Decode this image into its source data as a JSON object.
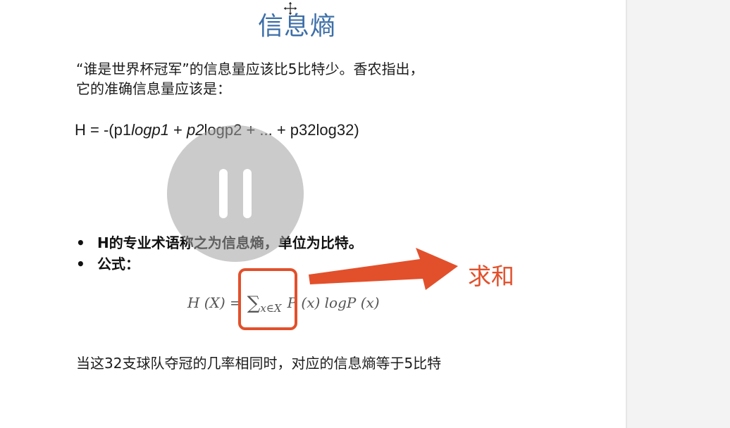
{
  "slide": {
    "title": "信息熵",
    "paragraph_line1": "“谁是世界杯冠军”的信息量应该比5比特少。香农指出，",
    "paragraph_line2": "它的准确信息量应该是：",
    "equation": {
      "part1": "H = -(p1",
      "part2_italic": "logp1",
      "part3": " + ",
      "part4_italic": "p2",
      "part5": "logp2 + ... + p32log32)"
    },
    "bullets": [
      {
        "marker": "•",
        "text": "H的专业术语称之为信息熵，单位为比特。"
      },
      {
        "marker": "•",
        "text": "公式："
      }
    ],
    "formula": {
      "lhs": "H (X) =",
      "sum": "∑",
      "sub": "x∈X",
      "rhs": "P (x) logP (x)"
    },
    "annotation": "求和",
    "footer": "当这32支球队夺冠的几率相同时，对应的信息熵等于5比特"
  },
  "overlay": {
    "pause_icon": "pause-icon"
  },
  "colors": {
    "title": "#3d6fa8",
    "annotation": "#e2502b",
    "slide_bg": "#ffffff",
    "side_bg": "#f3f3f3"
  }
}
